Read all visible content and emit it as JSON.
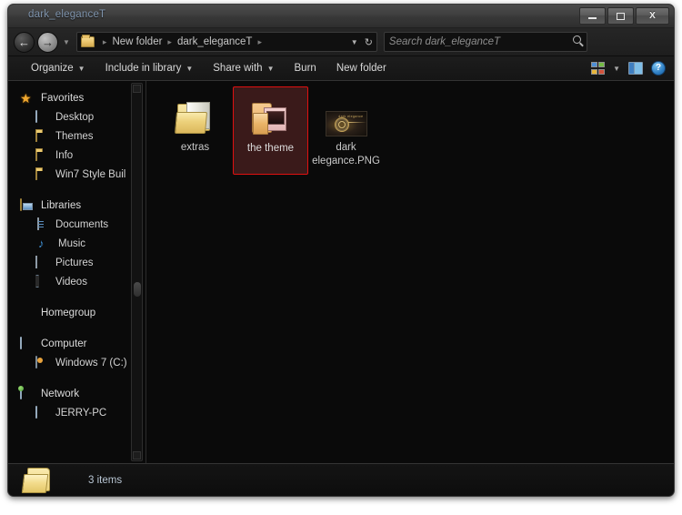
{
  "window": {
    "title": "dark_eleganceT",
    "buttons": {
      "minimize": "—",
      "maximize": "□",
      "close": "X"
    }
  },
  "address_bar": {
    "back_glyph": "←",
    "forward_glyph": "→",
    "history_caret": "▼",
    "breadcrumb": [
      {
        "label": "New folder"
      },
      {
        "label": "dark_eleganceT"
      }
    ],
    "separator": "▸",
    "previous_locations_caret": "▼",
    "refresh_glyph": "↻",
    "search": {
      "placeholder": "Search dark_eleganceT",
      "value": ""
    }
  },
  "toolbar": {
    "items": [
      {
        "label": "Organize",
        "caret": "▼"
      },
      {
        "label": "Include in library",
        "caret": "▼"
      },
      {
        "label": "Share with",
        "caret": "▼"
      },
      {
        "label": "Burn",
        "caret": ""
      },
      {
        "label": "New folder",
        "caret": ""
      }
    ],
    "view_caret": "▼",
    "help_label": "?"
  },
  "sidebar": {
    "sections": [
      {
        "group": "Favorites",
        "icon": "star-icon",
        "items": [
          {
            "label": "Desktop",
            "icon": "monitor-icon"
          },
          {
            "label": "Themes",
            "icon": "folder-icon"
          },
          {
            "label": "Info",
            "icon": "folder-icon"
          },
          {
            "label": "Win7 Style Buil",
            "icon": "folder-icon"
          }
        ]
      },
      {
        "group": "Libraries",
        "icon": "libraries-icon",
        "items": [
          {
            "label": "Documents",
            "icon": "document-icon"
          },
          {
            "label": "Music",
            "icon": "music-note-icon"
          },
          {
            "label": "Pictures",
            "icon": "picture-icon"
          },
          {
            "label": "Videos",
            "icon": "video-icon"
          }
        ]
      },
      {
        "group": "Homegroup",
        "icon": "homegroup-icon",
        "items": []
      },
      {
        "group": "Computer",
        "icon": "computer-icon",
        "items": [
          {
            "label": "Windows 7 (C:)",
            "icon": "drive-icon"
          }
        ]
      },
      {
        "group": "Network",
        "icon": "network-icon",
        "items": [
          {
            "label": "JERRY-PC",
            "icon": "pc-icon"
          }
        ]
      }
    ]
  },
  "content": {
    "items": [
      {
        "name": "extras",
        "type": "folder",
        "selected": false
      },
      {
        "name": "the theme",
        "type": "folder",
        "selected": true
      },
      {
        "name": "dark elegance.PNG",
        "type": "image",
        "selected": false
      }
    ],
    "thumbnail_caption": "dark elegance"
  },
  "status_bar": {
    "text": "3 items"
  },
  "colors": {
    "window_chrome": "#1b1b1b",
    "pane_background": "#0a0a0a",
    "title_text": "#7f94ad",
    "selection_fill": "#3a1a1a",
    "selection_border": "#e01010",
    "status_text": "#b9c6d4"
  }
}
